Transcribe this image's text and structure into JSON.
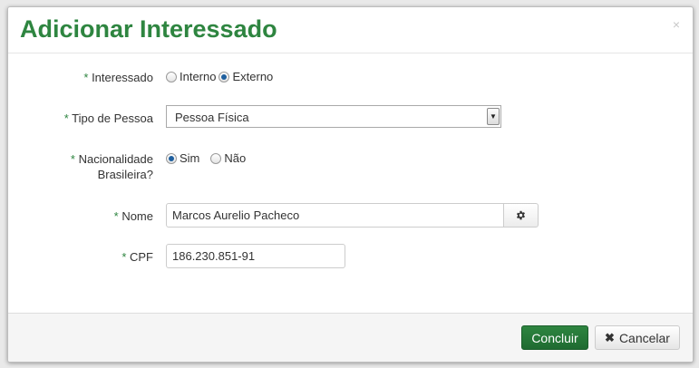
{
  "dialog": {
    "title": "Adicionar Interessado",
    "close_glyph": "×"
  },
  "form": {
    "required_mark": "*",
    "interessado": {
      "label": "Interessado",
      "options": [
        {
          "label": "Interno",
          "checked": false
        },
        {
          "label": "Externo",
          "checked": true
        }
      ]
    },
    "tipo_pessoa": {
      "label": "Tipo de Pessoa",
      "selected": "Pessoa Física"
    },
    "nacionalidade": {
      "label_line1": "Nacionalidade",
      "label_line2": "Brasileira?",
      "options": [
        {
          "label": "Sim",
          "checked": true
        },
        {
          "label": "Não",
          "checked": false
        }
      ]
    },
    "nome": {
      "label": "Nome",
      "value": "Marcos Aurelio Pacheco",
      "icon": "gear-icon"
    },
    "cpf": {
      "label": "CPF",
      "value": "186.230.851-91"
    }
  },
  "footer": {
    "concluir_label": "Concluir",
    "cancelar_label": "Cancelar",
    "cancelar_icon": "close-icon"
  },
  "colors": {
    "accent": "#2e8540",
    "radio_checked": "#1e5f9e"
  }
}
